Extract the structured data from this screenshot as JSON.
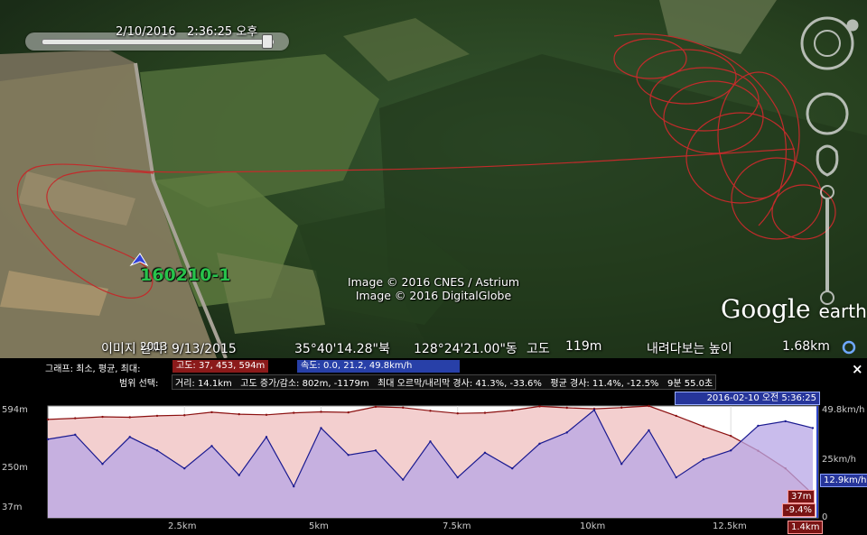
{
  "time_slider": {
    "label": "2/10/2016   2:36:25 오후"
  },
  "placemark": {
    "name": "160210-1",
    "icon": "paraglider-placemark-icon"
  },
  "credits": [
    "Image © 2016 CNES / Astrium",
    "Image © 2016 DigitalGlobe"
  ],
  "logo": {
    "main": "Google",
    "sub": "earth"
  },
  "status_bar": {
    "imagery_date": "이미지 날짜: 9/13/2015",
    "year_overlay": "2013",
    "lat": "35°40'14.28\"북",
    "lon": "128°24'21.00\"동",
    "elevation_label": "고도",
    "elevation_value": "119m",
    "eye_alt_label": "내려다보는 높이",
    "eye_alt_value": "1.68km"
  },
  "profile_panel": {
    "graph_label": "그래프: 최소, 평균, 최대:",
    "altitude_stats": "고도: 37, 453, 594m",
    "speed_stats": "속도: 0.0, 21.2, 49.8km/h",
    "range_label": "범위 선택:",
    "range_stats": "거리: 14.1km   고도 증가/감소: 802m, -1179m   최대 오르막/내리막 경사: 41.3%, -33.6%   평균 경사: 11.4%, -12.5%   9분 55.0초",
    "close": "×",
    "cursor_date": "2016-02-10 오전 5:36:25",
    "cursor_alt": "37m",
    "cursor_slope": "-9.4%",
    "cursor_dist": "1.4km",
    "cursor_speed": "12.9km/h",
    "y_left_ticks": [
      "594m",
      "250m",
      "37m"
    ],
    "y_right_ticks": [
      "49.8km/h",
      "25km/h",
      "0"
    ],
    "x_ticks": [
      "2.5km",
      "5km",
      "7.5km",
      "10km",
      "12.5km"
    ]
  },
  "colors": {
    "altitude_line": "#8b1010",
    "altitude_fill": "#f3cfcf",
    "speed_line": "#1a1a90",
    "speed_fill": "#b7a6e6",
    "track": "#c22b2b"
  },
  "chart_data": {
    "type": "area",
    "x": [
      0.0,
      0.5,
      1.0,
      1.5,
      2.0,
      2.5,
      3.0,
      3.5,
      4.0,
      4.5,
      5.0,
      5.5,
      6.0,
      6.5,
      7.0,
      7.5,
      8.0,
      8.5,
      9.0,
      9.5,
      10.0,
      10.5,
      11.0,
      11.5,
      12.0,
      12.5,
      13.0,
      13.5,
      14.0
    ],
    "xlim": [
      0,
      14.1
    ],
    "xlabel": "",
    "series": [
      {
        "name": "고도",
        "unit": "m",
        "axis": "left",
        "ylim": [
          37,
          594
        ],
        "values": [
          527,
          533,
          540,
          538,
          545,
          548,
          563,
          553,
          550,
          560,
          565,
          562,
          590,
          586,
          570,
          557,
          560,
          572,
          592,
          585,
          580,
          586,
          594,
          545,
          492,
          445,
          371,
          283,
          155
        ]
      },
      {
        "name": "속도",
        "unit": "km/h",
        "axis": "right",
        "ylim": [
          0,
          49.8
        ],
        "values": [
          35,
          37,
          24,
          36,
          30,
          22,
          32,
          19,
          36,
          14,
          40,
          28,
          30,
          17,
          34,
          18,
          29,
          22,
          33,
          38,
          48,
          24,
          39,
          18,
          26,
          30,
          41,
          43,
          40
        ]
      }
    ]
  }
}
